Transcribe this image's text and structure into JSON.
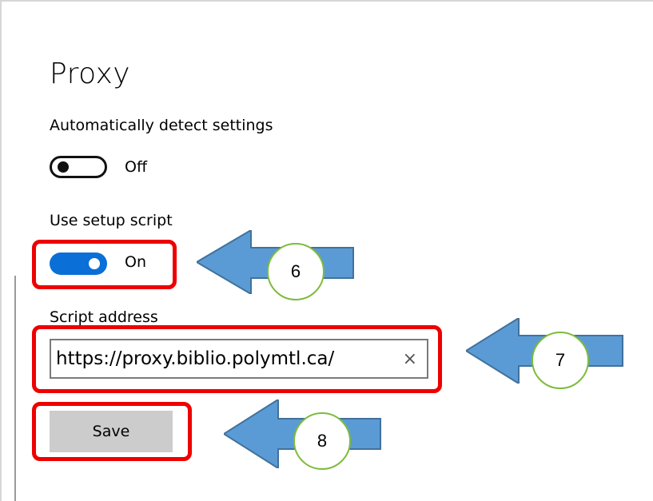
{
  "page": {
    "title": "Proxy"
  },
  "auto_detect": {
    "label": "Automatically detect settings",
    "state": "Off",
    "enabled": false
  },
  "setup_script": {
    "label": "Use setup script",
    "state": "On",
    "enabled": true
  },
  "script_address": {
    "label": "Script address",
    "value": "https://proxy.biblio.polymtl.ca/",
    "clear_glyph": "×"
  },
  "save": {
    "label": "Save"
  },
  "annotations": {
    "color_highlight": "#ee0000",
    "color_arrow": "#5b9bd5",
    "color_circle_border": "#7dbb3c",
    "steps": [
      "6",
      "7",
      "8"
    ]
  },
  "colors": {
    "toggle_on": "#0a6fd6",
    "button_bg": "#cccccc"
  }
}
